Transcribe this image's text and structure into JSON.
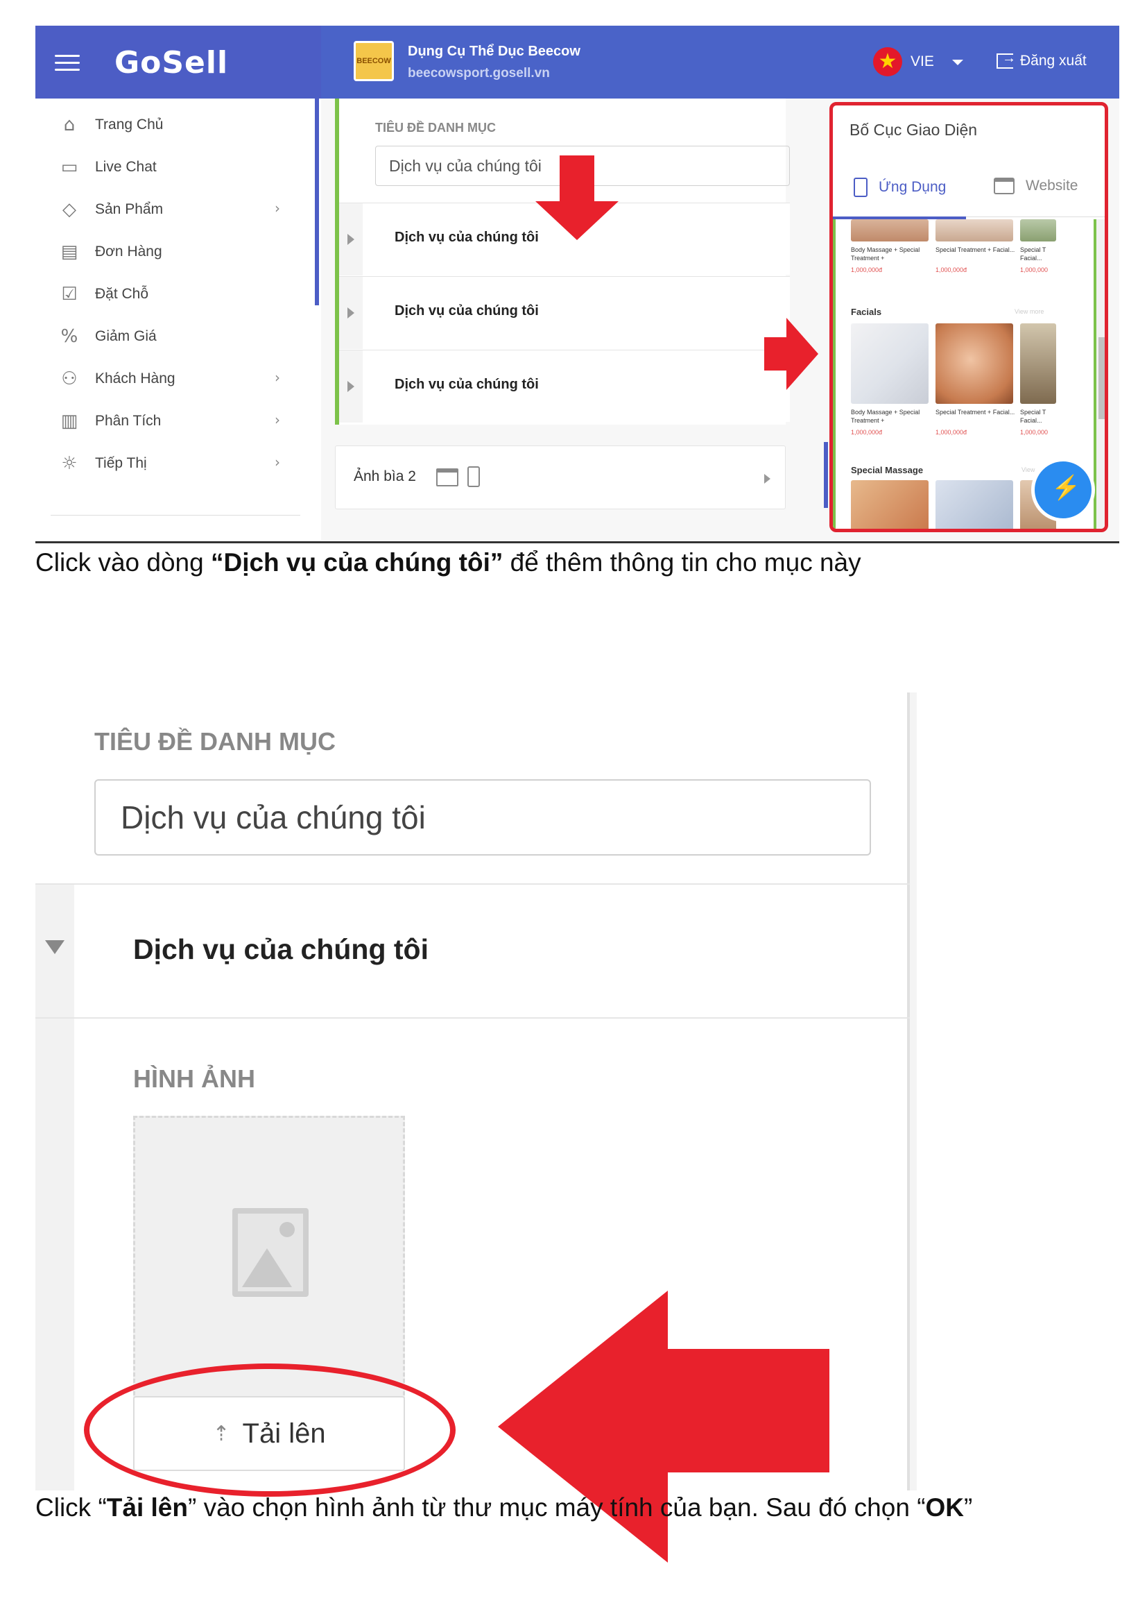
{
  "screen1": {
    "brand": "GoSell",
    "shop": {
      "name": "Dụng Cụ Thể Dục Beecow",
      "url": "beecowsport.gosell.vn",
      "logo_text": "BEECOW"
    },
    "language": "VIE",
    "logout": "Đăng xuất",
    "sidebar": [
      {
        "label": "Trang Chủ",
        "icon": "home-icon"
      },
      {
        "label": "Live Chat",
        "icon": "chat-icon"
      },
      {
        "label": "Sản Phẩm",
        "icon": "tag-icon",
        "expandable": true
      },
      {
        "label": "Đơn Hàng",
        "icon": "receipt-icon"
      },
      {
        "label": "Đặt Chỗ",
        "icon": "calendar-icon"
      },
      {
        "label": "Giảm Giá",
        "icon": "discount-icon"
      },
      {
        "label": "Khách Hàng",
        "icon": "users-icon",
        "expandable": true
      },
      {
        "label": "Phân Tích",
        "icon": "chart-icon",
        "expandable": true
      },
      {
        "label": "Tiếp Thị",
        "icon": "bulb-icon",
        "expandable": true
      }
    ],
    "category": {
      "label": "TIÊU ĐỀ DANH MỤC",
      "input_value": "Dịch vụ của chúng tôi",
      "rows": [
        "Dịch vụ của chúng tôi",
        "Dịch vụ của chúng tôi",
        "Dịch vụ của chúng tôi"
      ]
    },
    "cover": {
      "label": "Ảnh bìa 2"
    },
    "preview": {
      "title": "Bố Cục Giao Diện",
      "tabs": [
        "Ứng Dụng",
        "Website"
      ],
      "sections": [
        {
          "name": "",
          "items": [
            {
              "caption": "Body Massage + Special Treatment +",
              "price": "1,000,000đ"
            },
            {
              "caption": "Special Treatment + Facial...",
              "price": "1,000,000đ"
            },
            {
              "caption": "Special T Facial...",
              "price": "1,000,000"
            }
          ]
        },
        {
          "name": "Facials",
          "more": "View more",
          "items": [
            {
              "caption": "Body Massage + Special Treatment +",
              "price": "1,000,000đ"
            },
            {
              "caption": "Special Treatment + Facial...",
              "price": "1,000,000đ"
            },
            {
              "caption": "Special T Facial...",
              "price": "1,000,000"
            }
          ]
        },
        {
          "name": "Special Massage",
          "more": "View",
          "items": []
        }
      ]
    }
  },
  "caption1": {
    "prefix": "Click vào dòng ",
    "bold": "“Dịch vụ của chúng tôi”",
    "suffix": " để thêm thông tin cho mục này"
  },
  "screen2": {
    "category_label": "TIÊU ĐỀ DANH MỤC",
    "input_value": "Dịch vụ của chúng tôi",
    "row_label": "Dịch vụ của chúng tôi",
    "image_label": "HÌNH ẢNH",
    "upload_label": "Tải lên"
  },
  "caption2": {
    "p1": "Click “",
    "b1": "Tải lên",
    "p2": "” vào chọn hình ảnh từ thư mục máy tính của bạn. Sau đó chọn “",
    "b2": "OK",
    "p3": "”"
  },
  "colors": {
    "brand": "#4a63c8",
    "accent_red": "#e8212c",
    "green_bar": "#7cc24a"
  }
}
